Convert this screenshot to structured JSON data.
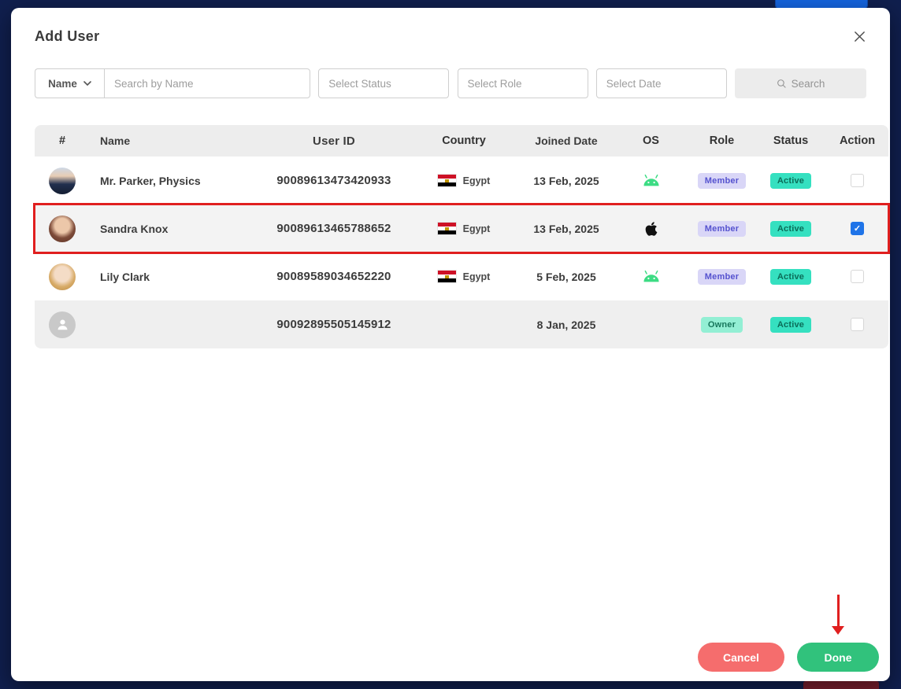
{
  "modal": {
    "title": "Add User"
  },
  "filters": {
    "name_dropdown_label": "Name",
    "search_placeholder": "Search by Name",
    "status_placeholder": "Select Status",
    "role_placeholder": "Select Role",
    "date_placeholder": "Select Date",
    "search_button_label": "Search"
  },
  "table": {
    "headers": [
      "#",
      "Name",
      "User ID",
      "Country",
      "Joined Date",
      "OS",
      "Role",
      "Status",
      "Action"
    ],
    "rows": [
      {
        "name": "Mr. Parker, Physics",
        "user_id": "90089613473420933",
        "country": "Egypt",
        "joined_date": "13 Feb, 2025",
        "os": "android",
        "role": "Member",
        "status": "Active",
        "checked": false,
        "selected": false,
        "avatar": "man-suit-photo"
      },
      {
        "name": "Sandra Knox",
        "user_id": "90089613465788652",
        "country": "Egypt",
        "joined_date": "13 Feb, 2025",
        "os": "apple",
        "role": "Member",
        "status": "Active",
        "checked": true,
        "selected": true,
        "avatar": "woman-brunette-photo"
      },
      {
        "name": "Lily Clark",
        "user_id": "90089589034652220",
        "country": "Egypt",
        "joined_date": "5 Feb, 2025",
        "os": "android",
        "role": "Member",
        "status": "Active",
        "checked": false,
        "selected": false,
        "avatar": "woman-blonde-photo"
      },
      {
        "name": "",
        "user_id": "90092895505145912",
        "country": "",
        "joined_date": "8 Jan, 2025",
        "os": "",
        "role": "Owner",
        "status": "Active",
        "checked": false,
        "selected": false,
        "avatar": "placeholder"
      }
    ]
  },
  "footer": {
    "cancel_label": "Cancel",
    "done_label": "Done"
  },
  "colors": {
    "selected_row_outline": "#e01f1f",
    "active_badge_bg": "#35e0c0",
    "member_badge_bg": "#d9d6f7",
    "owner_badge_bg": "#93efd4",
    "cancel_button": "#f56d6d",
    "done_button": "#31c27c",
    "checked_checkbox": "#1f74e8",
    "android_icon": "#3ddc84",
    "background": "#101f4e"
  }
}
